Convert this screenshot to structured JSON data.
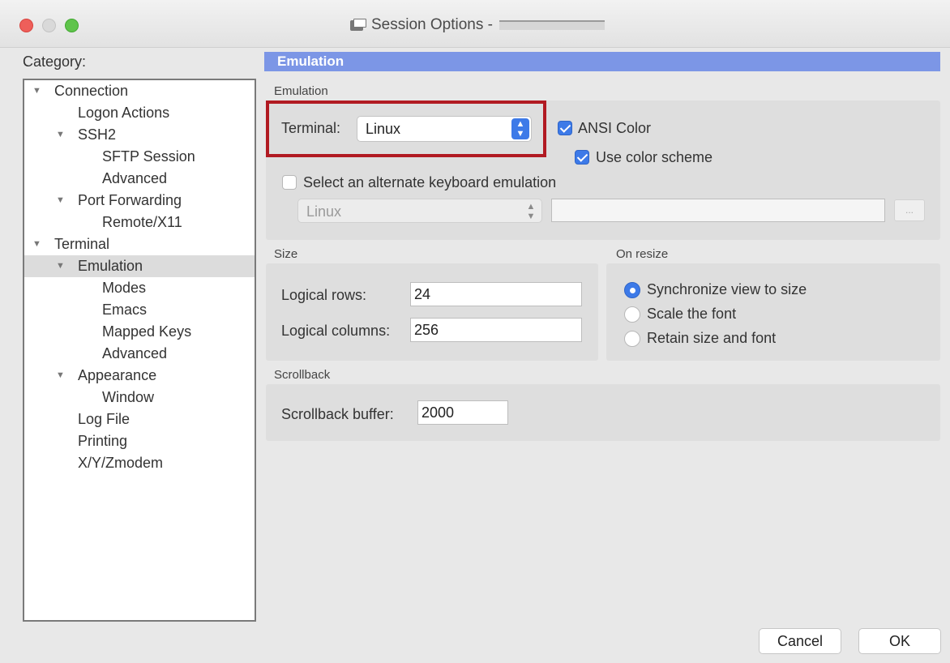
{
  "window": {
    "title": "Session Options -"
  },
  "sidebar": {
    "category_label": "Category:",
    "items": [
      {
        "label": "Connection",
        "expandable": true
      },
      {
        "label": "Logon Actions",
        "expandable": false
      },
      {
        "label": "SSH2",
        "expandable": true
      },
      {
        "label": "SFTP Session",
        "expandable": false
      },
      {
        "label": "Advanced",
        "expandable": false
      },
      {
        "label": "Port Forwarding",
        "expandable": true
      },
      {
        "label": "Remote/X11",
        "expandable": false
      },
      {
        "label": "Terminal",
        "expandable": true
      },
      {
        "label": "Emulation",
        "expandable": true,
        "selected": true
      },
      {
        "label": "Modes",
        "expandable": false
      },
      {
        "label": "Emacs",
        "expandable": false
      },
      {
        "label": "Mapped Keys",
        "expandable": false
      },
      {
        "label": "Advanced",
        "expandable": false
      },
      {
        "label": "Appearance",
        "expandable": true
      },
      {
        "label": "Window",
        "expandable": false
      },
      {
        "label": "Log File",
        "expandable": false
      },
      {
        "label": "Printing",
        "expandable": false
      },
      {
        "label": "X/Y/Zmodem",
        "expandable": false
      }
    ]
  },
  "panel": {
    "header": "Emulation",
    "emulation": {
      "group_label": "Emulation",
      "terminal_label": "Terminal:",
      "terminal_value": "Linux",
      "ansi_color_label": "ANSI Color",
      "ansi_color_checked": true,
      "use_color_scheme_label": "Use color scheme",
      "use_color_scheme_checked": true,
      "alt_keyboard_label": "Select an alternate keyboard emulation",
      "alt_keyboard_checked": false,
      "alt_keyboard_value": "Linux",
      "alt_keyboard_path": "",
      "browse_label": "..."
    },
    "size": {
      "group_label": "Size",
      "rows_label": "Logical rows:",
      "rows_value": "24",
      "columns_label": "Logical columns:",
      "columns_value": "256"
    },
    "on_resize": {
      "group_label": "On resize",
      "options": [
        {
          "label": "Synchronize view to size",
          "selected": true
        },
        {
          "label": "Scale the font",
          "selected": false
        },
        {
          "label": "Retain size and font",
          "selected": false
        }
      ]
    },
    "scrollback": {
      "group_label": "Scrollback",
      "buffer_label": "Scrollback buffer:",
      "buffer_value": "2000"
    }
  },
  "footer": {
    "cancel_label": "Cancel",
    "ok_label": "OK"
  },
  "colors": {
    "header_bar": "#7c96e6",
    "highlight_border": "#b11a22",
    "accent": "#3d7ae8"
  }
}
